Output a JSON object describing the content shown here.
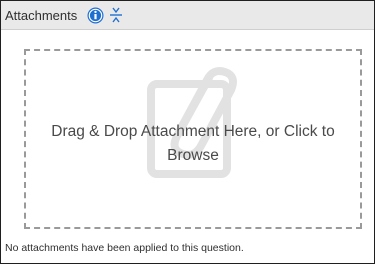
{
  "header": {
    "title": "Attachments",
    "info_icon": "info-icon",
    "collapse_icon": "collapse-vertical-icon",
    "accent_color": "#1f6fd1"
  },
  "dropzone": {
    "label": "Drag & Drop Attachment Here, or Click to Browse",
    "graphic_icon": "paperclip-document-icon"
  },
  "footer": {
    "note": "No attachments have been applied to this question."
  }
}
